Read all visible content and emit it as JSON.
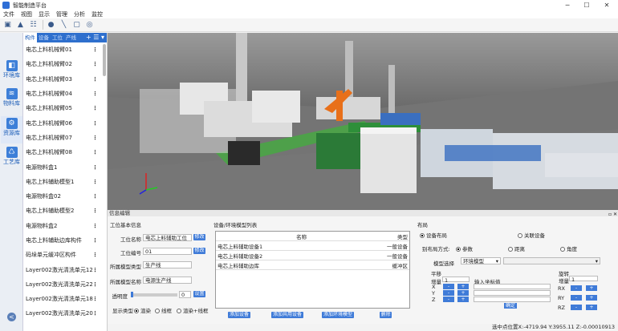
{
  "window": {
    "title": "智能制造平台",
    "minimize": "─",
    "maximize": "☐",
    "close": "✕"
  },
  "menu": [
    "文件",
    "视图",
    "显示",
    "管理",
    "分析",
    "监控"
  ],
  "toolbar": [
    "save-icon",
    "user-icon",
    "list-icon",
    "record-icon",
    "measure-icon",
    "frame-icon",
    "target-icon"
  ],
  "rail": [
    {
      "label": "环境库",
      "icon": "cube-icon"
    },
    {
      "label": "物料库",
      "icon": "layers-icon"
    },
    {
      "label": "资源库",
      "icon": "robot-arm-icon",
      "active": true
    },
    {
      "label": "工艺库",
      "icon": "recycle-icon"
    }
  ],
  "rail_collapse": "<",
  "list": {
    "tabs": [
      "构件",
      "设备",
      "工位",
      "产线"
    ],
    "active_tab": 0,
    "tools": "+ ☰ ▾",
    "items": [
      "电芯上料机械臂01",
      "电芯上料机械臂02",
      "电芯上料机械臂03",
      "电芯上料机械臂04",
      "电芯上料机械臂05",
      "电芯上料机械臂06",
      "电芯上料机械臂07",
      "电芯上料机械臂08",
      "电源物料盒1",
      "电芯上料辅助模型1",
      "电源物料盒02",
      "电芯上料辅助模型2",
      "电源物料盒2",
      "电芯上料辅助边库构件",
      "码垛单元缓冲区构件",
      "Layer002激光清洗单元12",
      "Layer002激光清洗单元22",
      "Layer002激光清洗单元18",
      "Layer002激光清洗单元20"
    ],
    "more": "⋮"
  },
  "info": {
    "header": "信息编辑",
    "basic": {
      "title": "工位基本信息",
      "name_label": "工位名称",
      "name_value": "电芯上料辅助工位",
      "change1": "修改",
      "code_label": "工位编号",
      "code_value": "01",
      "change2": "修改",
      "model_type_label": "所属模型类型",
      "model_type_value": "生产线",
      "model_name_label": "所属模型名称",
      "model_name_value": "电源生产线",
      "transparency_label": "透明度",
      "transparency_value": "0",
      "set_button": "设置",
      "display_label": "显示类型",
      "display_options": [
        "渲染",
        "线框",
        "渲染+线框"
      ]
    },
    "devices": {
      "title": "设备/环境模型列表",
      "columns": [
        "名称",
        "类型"
      ],
      "rows": [
        {
          "name": "电芯上料辅助设备1",
          "type": "一般设备"
        },
        {
          "name": "电芯上料辅助设备2",
          "type": "一般设备"
        },
        {
          "name": "电芯上料辅助边库",
          "type": "缓冲区"
        }
      ],
      "buttons": [
        "添加设备",
        "添加共用设备",
        "添加环境模型",
        "删除"
      ]
    },
    "layout": {
      "title": "布局",
      "mode_options": [
        "设备布局",
        "关联设备"
      ],
      "method_label": "别布局方式:",
      "method_options": [
        "参数",
        "距离",
        "角度"
      ],
      "model_select_label": "模型选择",
      "model_select_value": "环境模型",
      "translate": {
        "title": "平移",
        "step_label": "增量",
        "step_value": "1",
        "coord_label": "输入坐标值",
        "axes": [
          "X",
          "Y",
          "Z"
        ],
        "ok": "确定"
      },
      "rotate": {
        "title": "旋转",
        "step_label": "增量",
        "step_value": "1",
        "axes": [
          "RX",
          "RY",
          "RZ"
        ]
      },
      "minus": "-",
      "plus": "+"
    }
  },
  "status": "选中点位置X:-4719.94 Y:3955.11 Z:-0.00010913"
}
